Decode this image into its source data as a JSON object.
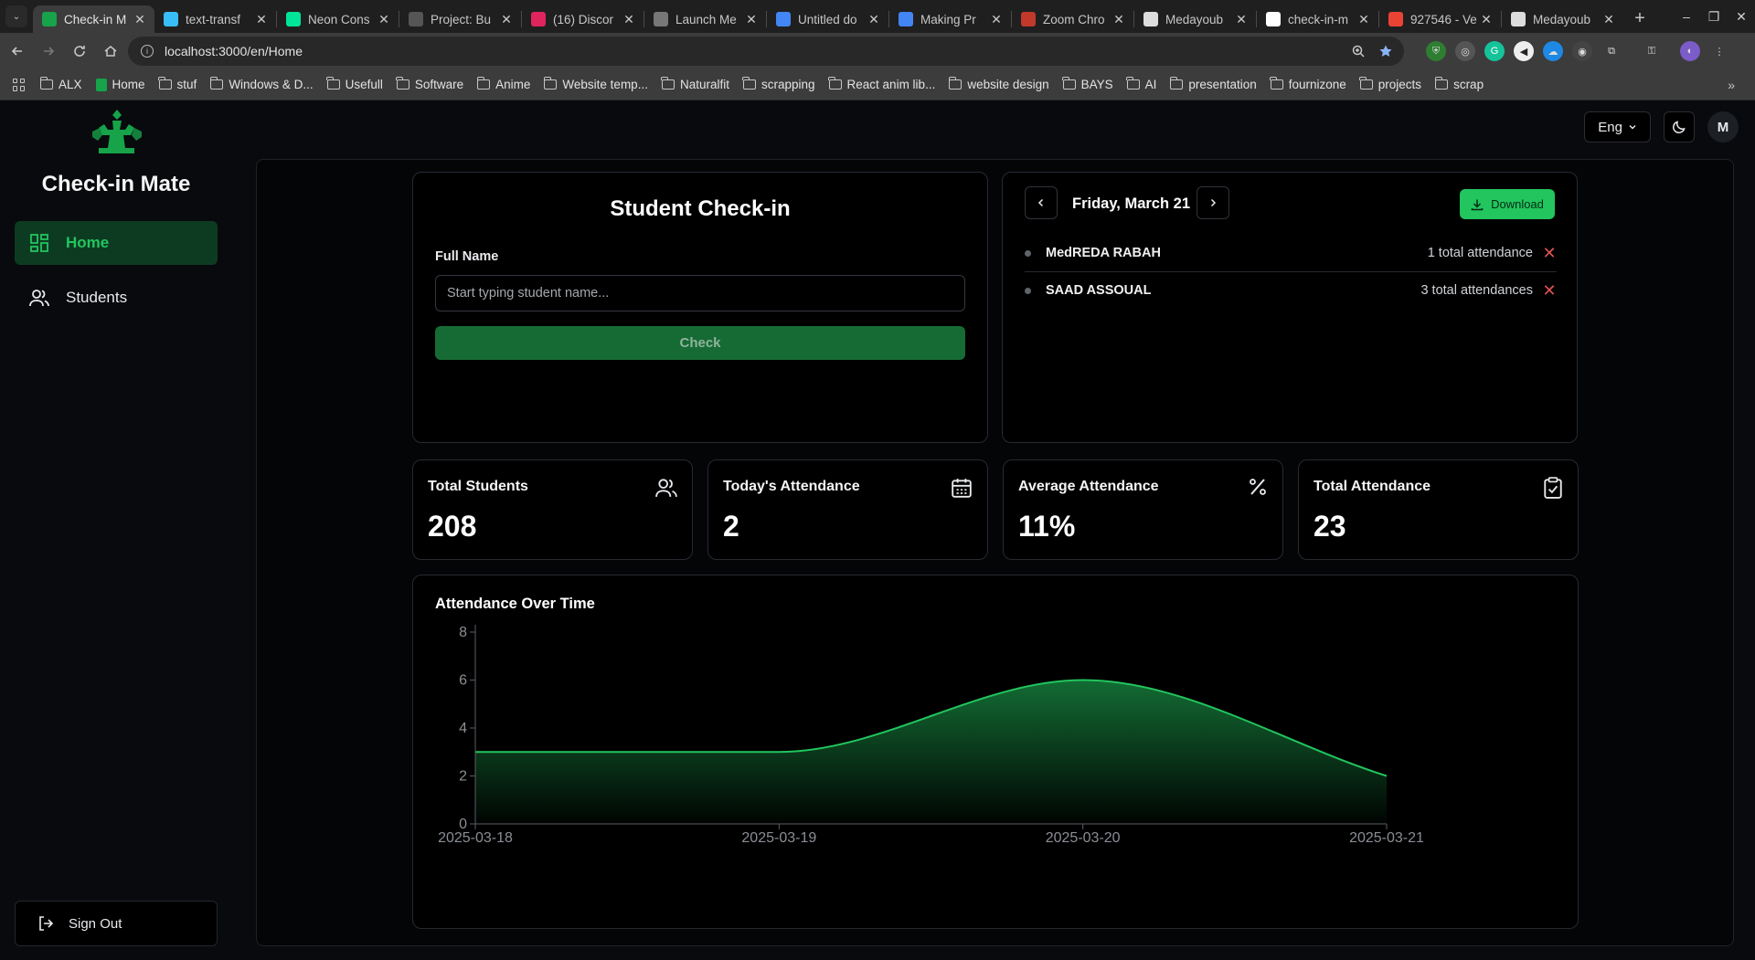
{
  "browser": {
    "tabs": [
      {
        "title": "Check-in M",
        "active": true,
        "fav_color": "#16a34a",
        "fav_icon": "app-logo-icon"
      },
      {
        "title": "text-transf",
        "fav_color": "#38bdf8",
        "fav_icon": "tailwind-icon"
      },
      {
        "title": "Neon Cons",
        "fav_color": "#00e599",
        "fav_icon": "neon-icon"
      },
      {
        "title": "Project: Bu",
        "fav_color": "#555555",
        "fav_icon": "project-icon"
      },
      {
        "title": "(16) Discor",
        "fav_color": "#e0245e",
        "fav_icon": "discord-icon"
      },
      {
        "title": "Launch Me",
        "fav_color": "#777777",
        "fav_icon": "launch-icon"
      },
      {
        "title": "Untitled do",
        "fav_color": "#4285f4",
        "fav_icon": "docs-icon"
      },
      {
        "title": "Making Pr",
        "fav_color": "#4285f4",
        "fav_icon": "docs-icon"
      },
      {
        "title": "Zoom Chro",
        "fav_color": "#c0392b",
        "fav_icon": "zoom-icon"
      },
      {
        "title": "Medayoub",
        "fav_color": "#dddddd",
        "fav_icon": "github-icon"
      },
      {
        "title": "check-in-m",
        "fav_color": "#ffffff",
        "fav_icon": "vercel-icon"
      },
      {
        "title": "927546 - Ve",
        "fav_color": "#ea4335",
        "fav_icon": "gmail-icon"
      },
      {
        "title": "Medayoub",
        "fav_color": "#dddddd",
        "fav_icon": "github-icon"
      }
    ],
    "address": "localhost:3000/en/Home",
    "bookmarks": [
      {
        "label": "ALX",
        "type": "folder"
      },
      {
        "label": "Home",
        "type": "link"
      },
      {
        "label": "stuf",
        "type": "folder"
      },
      {
        "label": "Windows & D...",
        "type": "folder"
      },
      {
        "label": "Usefull",
        "type": "folder"
      },
      {
        "label": "Software",
        "type": "folder"
      },
      {
        "label": "Anime",
        "type": "folder"
      },
      {
        "label": "Website temp...",
        "type": "folder"
      },
      {
        "label": "Naturalfit",
        "type": "folder"
      },
      {
        "label": "scrapping",
        "type": "folder"
      },
      {
        "label": "React anim lib...",
        "type": "folder"
      },
      {
        "label": "website design",
        "type": "folder"
      },
      {
        "label": "BAYS",
        "type": "folder"
      },
      {
        "label": "AI",
        "type": "folder"
      },
      {
        "label": "presentation",
        "type": "folder"
      },
      {
        "label": "fournizone",
        "type": "folder"
      },
      {
        "label": "projects",
        "type": "folder"
      },
      {
        "label": "scrap",
        "type": "folder"
      }
    ]
  },
  "app": {
    "brand": "Check-in Mate",
    "accent": "#22c55e",
    "nav": [
      {
        "label": "Home",
        "icon": "dashboard-icon",
        "active": true
      },
      {
        "label": "Students",
        "icon": "users-icon",
        "active": false
      }
    ],
    "sign_out": "Sign Out",
    "header": {
      "language": "Eng",
      "avatar_initial": "M"
    }
  },
  "checkin": {
    "title": "Student Check-in",
    "field_label": "Full Name",
    "placeholder": "Start typing student name...",
    "button": "Check"
  },
  "attendance": {
    "date": "Friday, March 21",
    "download": "Download",
    "rows": [
      {
        "name": "MedREDA RABAH",
        "count": "1 total attendance"
      },
      {
        "name": "SAAD ASSOUAL",
        "count": "3 total attendances"
      }
    ]
  },
  "stats": [
    {
      "title": "Total Students",
      "value": "208",
      "icon": "users-icon"
    },
    {
      "title": "Today's Attendance",
      "value": "2",
      "icon": "calendar-icon"
    },
    {
      "title": "Average Attendance",
      "value": "11%",
      "icon": "percent-icon"
    },
    {
      "title": "Total Attendance",
      "value": "23",
      "icon": "clipboard-check-icon"
    }
  ],
  "chart_data": {
    "type": "area",
    "title": "Attendance Over Time",
    "x": [
      "2025-03-18",
      "2025-03-19",
      "2025-03-20",
      "2025-03-21"
    ],
    "series": [
      {
        "values": [
          3,
          3,
          6,
          2
        ]
      }
    ],
    "yticks": [
      0,
      2,
      4,
      6,
      8
    ],
    "ylim": [
      0,
      8
    ],
    "curve": "monotone",
    "color": "#22c55e",
    "grid": false
  }
}
